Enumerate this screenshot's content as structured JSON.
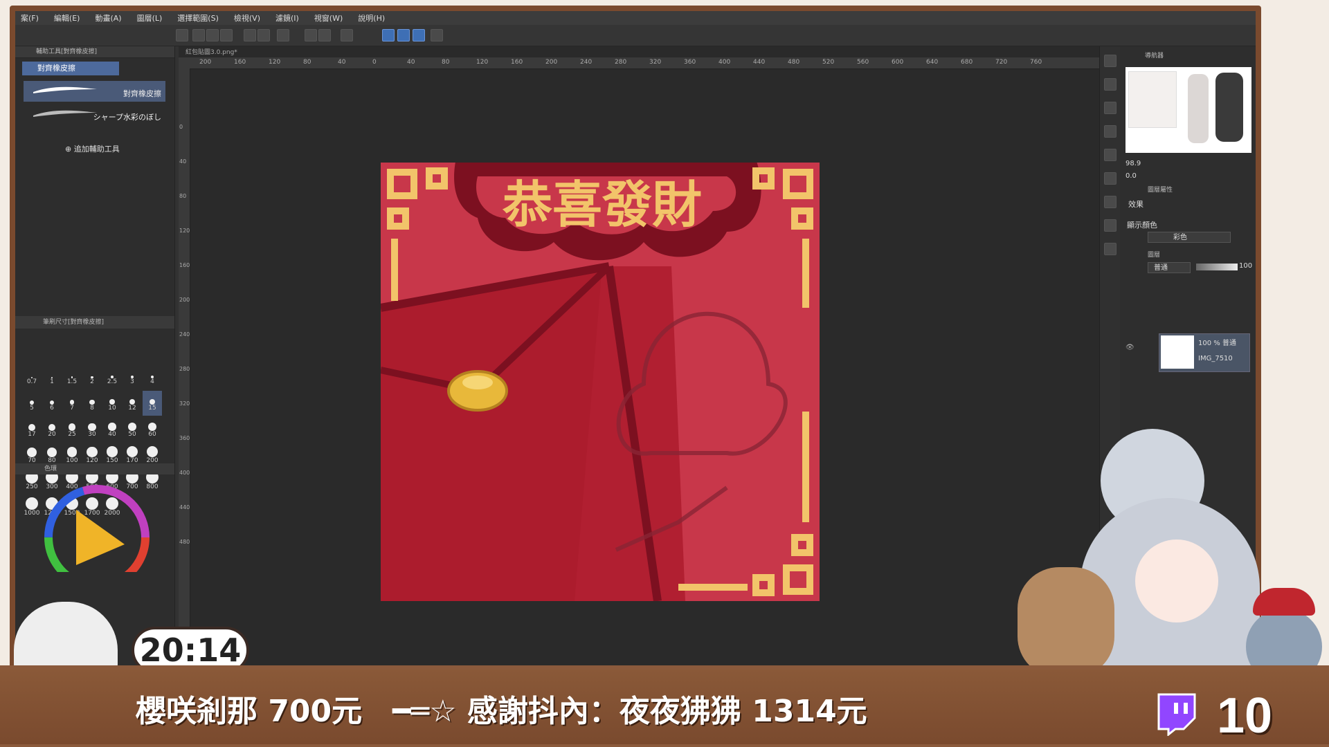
{
  "menu": {
    "items": [
      "案(F)",
      "編輯(E)",
      "動畫(A)",
      "圖層(L)",
      "選擇範圍(S)",
      "檢視(V)",
      "濾鏡(I)",
      "視窗(W)",
      "說明(H)"
    ]
  },
  "left_panel": {
    "subtool_header": "輔助工具[對齊橡皮擦]",
    "subtool_group": "對齊橡皮擦",
    "subtools": [
      {
        "label": "對齊橡皮擦",
        "selected": true
      },
      {
        "label": "シャープ水彩のぼし",
        "selected": false
      }
    ],
    "add_subtool": "追加輔助工具",
    "brush_size_header": "筆刷尺寸[對齊橡皮擦]",
    "brush_sizes": [
      "0.7",
      "1",
      "1.5",
      "2",
      "2.5",
      "3",
      "4",
      "5",
      "6",
      "7",
      "8",
      "10",
      "12",
      "15",
      "17",
      "20",
      "25",
      "30",
      "40",
      "50",
      "60",
      "70",
      "80",
      "100",
      "120",
      "150",
      "170",
      "200",
      "250",
      "300",
      "400",
      "500",
      "600",
      "700",
      "800",
      "1000",
      "1200",
      "1500",
      "1700",
      "2000"
    ],
    "selected_brush_size": "15",
    "color_panel_label": "色環"
  },
  "canvas": {
    "tab_name": "紅包貼圖3.0.png*",
    "ruler_h": [
      "200",
      "160",
      "120",
      "80",
      "40",
      "0",
      "40",
      "80",
      "120",
      "160",
      "200",
      "240",
      "280",
      "320",
      "360",
      "400",
      "440",
      "480",
      "520",
      "560",
      "600",
      "640",
      "680",
      "720",
      "760"
    ],
    "ruler_v": [
      "0",
      "40",
      "80",
      "120",
      "160",
      "200",
      "240",
      "280",
      "320",
      "360",
      "400",
      "440",
      "480"
    ]
  },
  "artwork": {
    "banner_text": "恭喜發財",
    "colors": {
      "bg": "#c8374a",
      "dark": "#7c1020",
      "gold": "#f2c46a",
      "envelope": "#b11f31"
    }
  },
  "right_panel": {
    "navigator_label": "導航器",
    "zoom_value": "98.9",
    "rotate_value": "0.0",
    "properties_label": "圖層屬性",
    "effect_label": "效果",
    "display_color_label": "顯示顏色",
    "display_color_value": "彩色",
    "layer_tab": "圖層",
    "blend_mode": "普通",
    "opacity": "100",
    "layer": {
      "opacity_mode": "100 % 普通",
      "name": "IMG_7510"
    }
  },
  "overlay": {
    "clock": "20:14",
    "ticker": "櫻咲剎那 700元　━═☆ 感謝抖內：夜夜狒狒 1314元",
    "follower_count": "10",
    "accent_colors": {
      "wood": "#8a5938",
      "twitch": "#9146ff"
    }
  }
}
